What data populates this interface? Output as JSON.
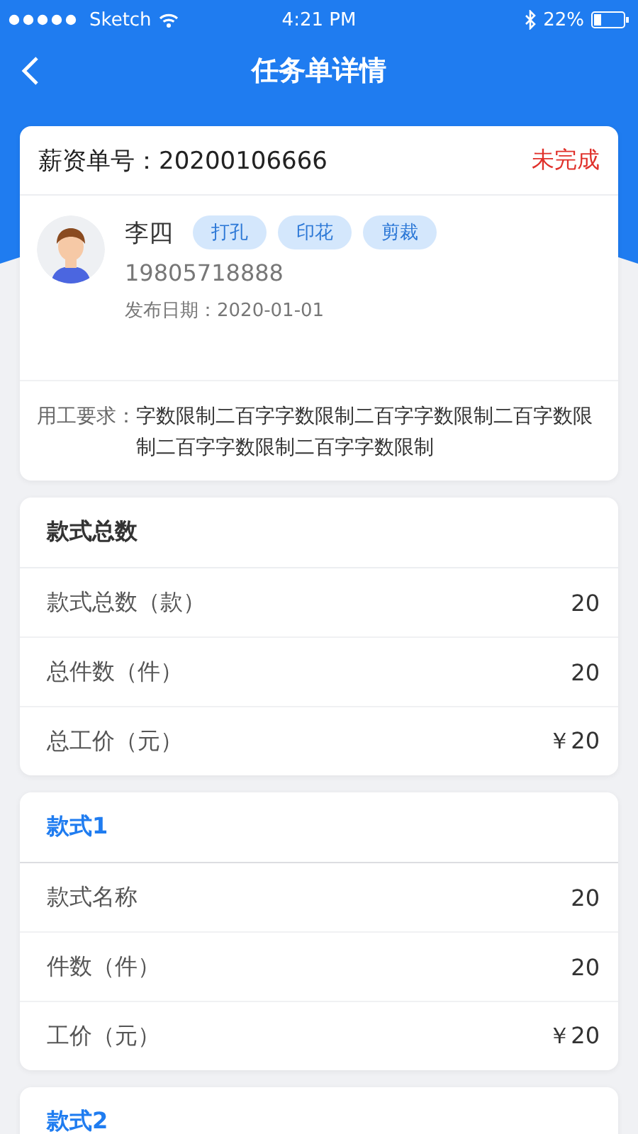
{
  "status_bar": {
    "carrier": "Sketch",
    "time": "4:21 PM",
    "battery": "22%"
  },
  "nav": {
    "title": "任务单详情"
  },
  "order": {
    "label": "薪资单号：",
    "number": "20200106666",
    "status": "未完成",
    "completed": false,
    "name": "李四",
    "tags": [
      "打孔",
      "印花",
      "剪裁"
    ],
    "phone": "19805718888",
    "date": "发布日期：2020-01-01",
    "requirement_label": "用工要求：",
    "requirement": "字数限制二百字字数限制二百字字数限制二百字数限制二百字字数限制二百字字数限制"
  },
  "sections": [
    {
      "kind": "summary",
      "title": "款式总数",
      "rows": [
        {
          "label": "款式总数（款）",
          "value": "20"
        },
        {
          "label": "总件数（件）",
          "value": "20"
        },
        {
          "label": "总工价（元）",
          "value": "￥20"
        }
      ]
    },
    {
      "kind": "style",
      "title": "款式1",
      "rows": [
        {
          "label": "款式名称",
          "value": "20"
        },
        {
          "label": "件数（件）",
          "value": "20"
        },
        {
          "label": "工价（元）",
          "value": "￥20"
        }
      ]
    },
    {
      "kind": "style",
      "title": "款式2"
    }
  ]
}
